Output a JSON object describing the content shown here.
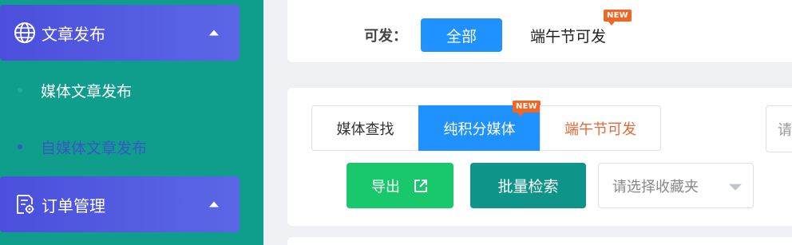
{
  "sidebar": {
    "groups": [
      {
        "label": "文章发布",
        "icon": "globe-icon"
      },
      {
        "label": "订单管理",
        "icon": "order-settings-icon"
      }
    ],
    "items": [
      {
        "label": "媒体文章发布",
        "color": "#ffffff",
        "dot_color": "#1ab09e"
      },
      {
        "label": "自媒体文章发布",
        "color": "#3a56c8",
        "dot_color": "#3a56c8"
      }
    ],
    "bg_color": "#0f9d8c",
    "group_color": "#5059df"
  },
  "filter": {
    "label": "可发：",
    "chip_all": "全部",
    "chip_dragon": "端午节可发",
    "badge": "NEW"
  },
  "tabs": [
    {
      "label": "媒体查找"
    },
    {
      "label": "纯积分媒体",
      "badge": "NEW"
    },
    {
      "label": "端午节可发"
    }
  ],
  "search": {
    "placeholder_partial": "请"
  },
  "actions": {
    "export_label": "导出",
    "batch_label": "批量检索",
    "favorites_placeholder": "请选择收藏夹"
  },
  "colors": {
    "primary": "#1f92ff",
    "export_green": "#19c86b",
    "batch_teal": "#0e9488",
    "badge_orange": "#f26522",
    "dragon_text": "#e8683a"
  }
}
